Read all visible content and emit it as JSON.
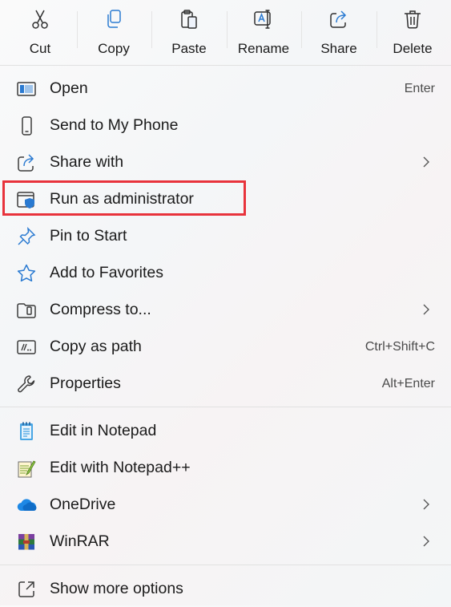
{
  "toolbar": {
    "cut": {
      "label": "Cut",
      "icon": "scissors-icon"
    },
    "copy": {
      "label": "Copy",
      "icon": "copy-icon"
    },
    "paste": {
      "label": "Paste",
      "icon": "clipboard-icon"
    },
    "rename": {
      "label": "Rename",
      "icon": "rename-icon"
    },
    "share": {
      "label": "Share",
      "icon": "share-icon"
    },
    "delete": {
      "label": "Delete",
      "icon": "trash-icon"
    }
  },
  "items": {
    "open": {
      "label": "Open",
      "shortcut": "Enter",
      "icon": "open-window-icon"
    },
    "send_to_phone": {
      "label": "Send to My Phone",
      "icon": "phone-icon"
    },
    "share_with": {
      "label": "Share with",
      "icon": "share-icon",
      "has_submenu": true
    },
    "run_as_admin": {
      "label": "Run as administrator",
      "icon": "shield-window-icon",
      "highlighted": true
    },
    "pin_to_start": {
      "label": "Pin to Start",
      "icon": "pin-icon"
    },
    "add_to_favorites": {
      "label": "Add to Favorites",
      "icon": "star-icon"
    },
    "compress_to": {
      "label": "Compress to...",
      "icon": "zip-folder-icon",
      "has_submenu": true
    },
    "copy_as_path": {
      "label": "Copy as path",
      "shortcut": "Ctrl+Shift+C",
      "icon": "path-icon"
    },
    "properties": {
      "label": "Properties",
      "shortcut": "Alt+Enter",
      "icon": "wrench-icon"
    },
    "edit_notepad": {
      "label": "Edit in Notepad",
      "icon": "notepad-icon"
    },
    "edit_notepadpp": {
      "label": "Edit with Notepad++",
      "icon": "notepadpp-icon"
    },
    "onedrive": {
      "label": "OneDrive",
      "icon": "onedrive-cloud-icon",
      "has_submenu": true
    },
    "winrar": {
      "label": "WinRAR",
      "icon": "winrar-icon",
      "has_submenu": true
    },
    "show_more": {
      "label": "Show more options",
      "icon": "expand-icon"
    }
  },
  "colors": {
    "accent": "#2a7ad1",
    "highlight_border": "#e8333c",
    "onedrive": "#1e88e5"
  }
}
